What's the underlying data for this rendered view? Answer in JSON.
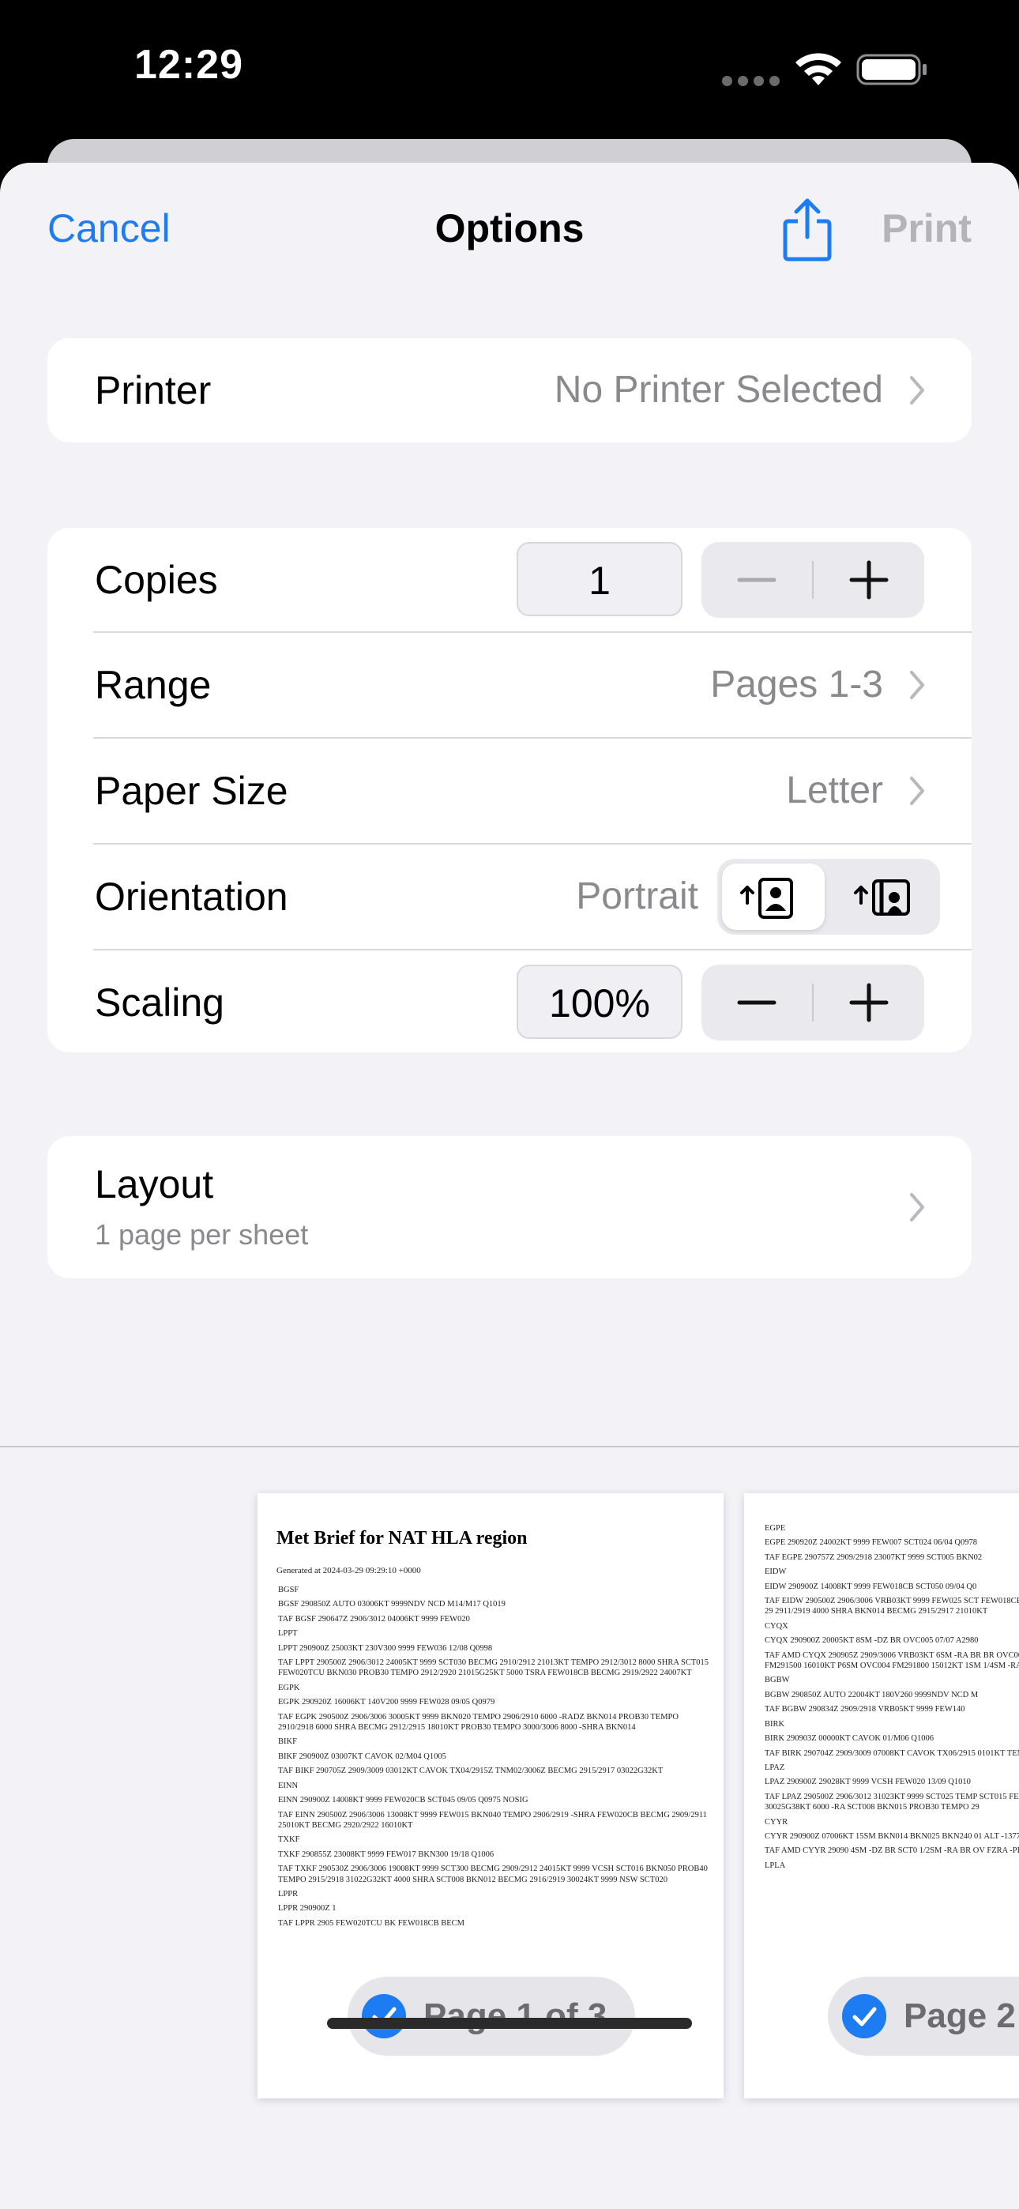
{
  "status_bar": {
    "time": "12:29"
  },
  "nav": {
    "cancel": "Cancel",
    "title": "Options",
    "print": "Print",
    "share_icon": "share-icon"
  },
  "printer": {
    "label": "Printer",
    "value": "No Printer Selected"
  },
  "options": {
    "copies": {
      "label": "Copies",
      "value": "1"
    },
    "range": {
      "label": "Range",
      "value": "Pages 1-3"
    },
    "paper_size": {
      "label": "Paper Size",
      "value": "Letter"
    },
    "orientation": {
      "label": "Orientation",
      "value": "Portrait",
      "selected": "portrait"
    },
    "scaling": {
      "label": "Scaling",
      "value": "100%"
    }
  },
  "layout": {
    "label": "Layout",
    "value": "1 page per sheet"
  },
  "preview": {
    "pages": [
      {
        "title": "Met Brief for NAT HLA region",
        "generated": "Generated at 2024-03-29 09:29:10 +0000",
        "lines": [
          "BGSF",
          "BGSF 290850Z AUTO 03006KT 9999NDV NCD M14/M17 Q1019",
          "TAF BGSF 290647Z 2906/3012 04006KT 9999 FEW020",
          "LPPT",
          "LPPT 290900Z 25003KT 230V300 9999 FEW036 12/08 Q0998",
          "TAF LPPT 290500Z 2906/3012 24005KT 9999 SCT030 BECMG 2910/2912 21013KT TEMPO 2912/3012 8000 SHRA SCT015 FEW020TCU BKN030 PROB30 TEMPO 2912/2920 21015G25KT 5000 TSRA FEW018CB BECMG 2919/2922 24007KT",
          "EGPK",
          "EGPK 290920Z 16006KT 140V200 9999 FEW028 09/05 Q0979",
          "TAF EGPK 290500Z 2906/3006 30005KT 9999 BKN020 TEMPO 2906/2910 6000 -RADZ BKN014 PROB30 TEMPO 2910/2918 6000 SHRA BECMG 2912/2915 18010KT PROB30 TEMPO 3000/3006 8000 -SHRA BKN014",
          "BIKF",
          "BIKF 290900Z 03007KT CAVOK 02/M04 Q1005",
          "TAF BIKF 290705Z 2909/3009 03012KT CAVOK TX04/2915Z TNM02/3006Z BECMG 2915/2917 03022G32KT",
          "EINN",
          "EINN 290900Z 14008KT 9999 FEW020CB SCT045 09/05 Q0975 NOSIG",
          "TAF EINN 290500Z 2906/3006 13008KT 9999 FEW015 BKN040 TEMPO 2906/2919 -SHRA FEW020CB BECMG 2909/2911 25010KT BECMG 2920/2922 16010KT",
          "TXKF",
          "TXKF 290855Z 23008KT 9999 FEW017 BKN300 19/18 Q1006",
          "TAF TXKF 290530Z 2906/3006 19008KT 9999 SCT300 BECMG 2909/2912 24015KT 9999 VCSH SCT016 BKN050 PROB40 TEMPO 2915/2918 31022G32KT 4000 SHRA SCT008 BKN012 BECMG 2916/2919 30024KT 9999 NSW SCT020",
          "LPPR",
          "LPPR 290900Z 1",
          "TAF LPPR 2905 FEW020TCU BK FEW018CB BECM"
        ],
        "badge": "Page 1 of 3"
      },
      {
        "lines": [
          "EGPE",
          "EGPE 290920Z 24002KT 9999 FEW007 SCT024 06/04 Q0978",
          "TAF EGPE 290757Z 2909/2918 23007KT 9999 SCT005 BKN02",
          "EIDW",
          "EIDW 290900Z 14008KT 9999 FEW018CB SCT050 09/04 Q0",
          "TAF EIDW 290500Z 2906/3006 VRB03KT 9999 FEW025 SCT FEW018CB BECMG 2908/2910 16012KT PROB40 TEMPO 29 2911/2919 4000 SHRA BKN014 BECMG 2915/2917 21010KT",
          "CYQX",
          "CYQX 290900Z 20005KT 8SM -DZ BR OVC005 07/07 A2980",
          "TAF AMD CYQX 290905Z 2909/3006 VRB03KT 6SM -RA BR BR OVC003 PROB30 2909/2913 3/8SM -RA -DZ FG VV001 FM291500 16010KT P6SM OVC004 FM291800 15012KT 1SM 1/4SM -RA FG VV001 RMK NXT FCST BY 291200Z",
          "BGBW",
          "BGBW 290850Z AUTO 22004KT 180V260 9999NDV NCD M",
          "TAF BGBW 290834Z 2909/2918 VRB05KT 9999 FEW140",
          "BIRK",
          "BIRK 290903Z 00000KT CAVOK 01/M06 Q1006",
          "TAF BIRK 290704Z 2909/3009 07008KT CAVOK TX06/2915 0101KT TEMPO 2917/3006 01022G32KT",
          "LPAZ",
          "LPAZ 290900Z 29028KT 9999 VCSH FEW020 13/09 Q1010",
          "TAF LPAZ 290500Z 2906/3012 31023KT 9999 SCT025 TEMP SCT015 FEW020TCU BKN030 BECMG 2912/2914 30020G32 30025G38KT 6000 -RA SCT008 BKN015 PROB30 TEMPO 29",
          "CYYR",
          "CYYR 290900Z 07006KT 15SM BKN014 BKN025 BKN240 01 ALT -1377FT CIG EST SLP126",
          "TAF AMD CYYR 29090 4SM -DZ BR SCT0 1/2SM -RA BR OV FZRA -PL BR OV RMK NXT FCS",
          "LPLA"
        ],
        "badge": "Page 2"
      }
    ]
  },
  "colors": {
    "accent": "#1e7cf2",
    "background": "#f2f2f7",
    "secondary_text": "#8a8a8e",
    "disabled": "#b3b3b8"
  }
}
